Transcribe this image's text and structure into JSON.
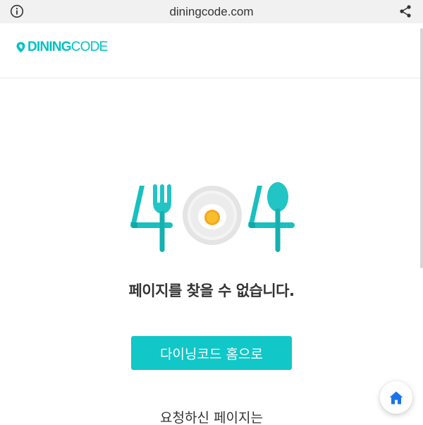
{
  "browser": {
    "url": "diningcode.com",
    "info_icon": "info-icon",
    "share_icon": "share-icon"
  },
  "header": {
    "logo_bold": "DINING",
    "logo_light": "CODE",
    "brand_color": "#00c2c2"
  },
  "error_page": {
    "art": "404-fork-plate-spoon-illustration",
    "message": "페이지를 찾을 수 없습니다.",
    "home_button_label": "다이닝코드 홈으로",
    "sub_message": "요청하신 페이지는",
    "button_color": "#11c7c7"
  },
  "fab": {
    "icon": "home-icon",
    "color": "#1a73e8"
  }
}
